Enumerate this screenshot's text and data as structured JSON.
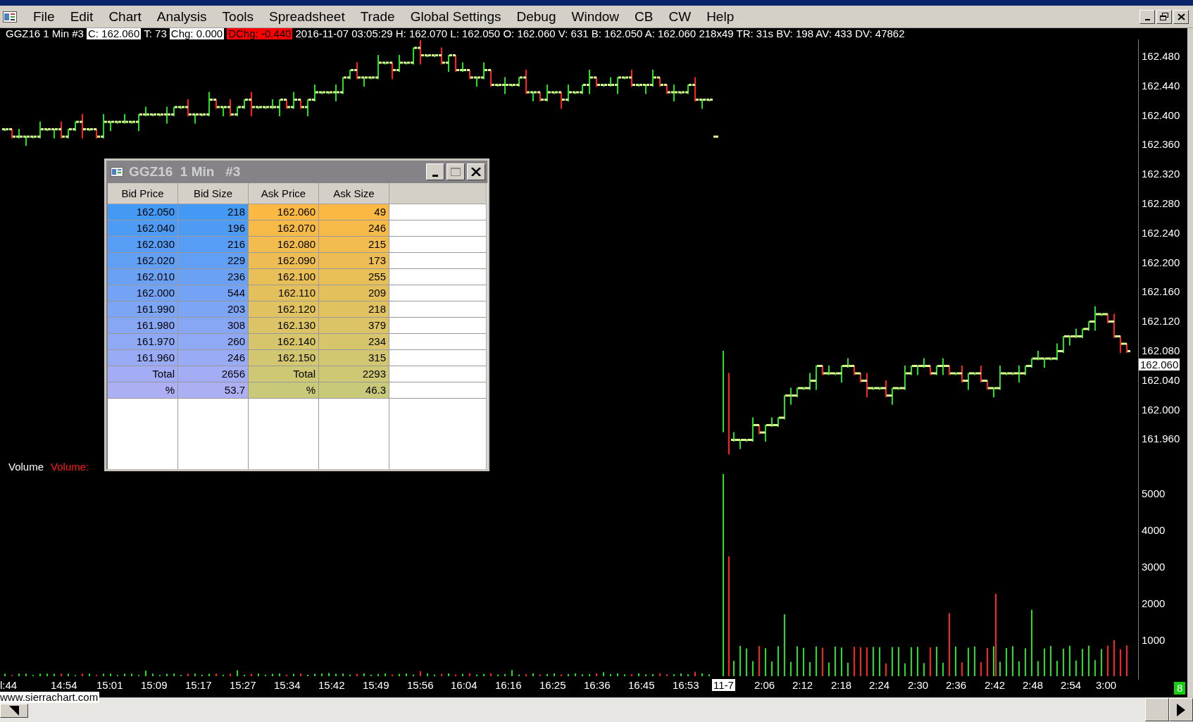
{
  "menu": [
    "File",
    "Edit",
    "Chart",
    "Analysis",
    "Tools",
    "Spreadsheet",
    "Trade",
    "Global Settings",
    "Debug",
    "Window",
    "CB",
    "CW",
    "Help"
  ],
  "info_line": [
    {
      "text": "GGZ16  1 Min  #3",
      "kind": "plain"
    },
    {
      "text": "C: 162.060",
      "kind": "boxed"
    },
    {
      "text": "T: 73",
      "kind": "plain"
    },
    {
      "text": "Chg: 0.000",
      "kind": "boxed"
    },
    {
      "text": "DChg: -0.440",
      "kind": "alert"
    },
    {
      "text": "2016-11-07 03:05:29 H: 162.070 L: 162.050 O: 162.060 V: 631 B: 162.050 A: 162.060 218x49 TR: 31s BV: 198 AV: 433 DV: 47862",
      "kind": "plain"
    }
  ],
  "price_axis": {
    "labels": [
      "162.480",
      "162.440",
      "162.400",
      "162.360",
      "162.320",
      "162.280",
      "162.240",
      "162.200",
      "162.160",
      "162.120",
      "162.080",
      "162.040",
      "162.000",
      "161.960"
    ],
    "current": "162.060"
  },
  "volume_axis": {
    "labels": [
      "5000",
      "4000",
      "3000",
      "2000",
      "1000"
    ]
  },
  "volume_legend": [
    {
      "text": "Volume",
      "kind": "name"
    },
    {
      "text": "Volume:",
      "kind": "value"
    }
  ],
  "time_axis": [
    {
      "text": "l:44",
      "kind": "plain"
    },
    {
      "text": "14:54",
      "kind": "plain"
    },
    {
      "text": "15:01",
      "kind": "plain"
    },
    {
      "text": "15:09",
      "kind": "plain"
    },
    {
      "text": "15:17",
      "kind": "plain"
    },
    {
      "text": "15:27",
      "kind": "plain"
    },
    {
      "text": "15:34",
      "kind": "plain"
    },
    {
      "text": "15:42",
      "kind": "plain"
    },
    {
      "text": "15:49",
      "kind": "plain"
    },
    {
      "text": "15:56",
      "kind": "plain"
    },
    {
      "text": "16:04",
      "kind": "plain"
    },
    {
      "text": "16:16",
      "kind": "plain"
    },
    {
      "text": "16:25",
      "kind": "plain"
    },
    {
      "text": "16:36",
      "kind": "plain"
    },
    {
      "text": "16:45",
      "kind": "plain"
    },
    {
      "text": "16:53",
      "kind": "plain"
    },
    {
      "text": "11-7",
      "kind": "date"
    },
    {
      "text": "2:06",
      "kind": "plain"
    },
    {
      "text": "2:12",
      "kind": "plain"
    },
    {
      "text": "2:18",
      "kind": "plain"
    },
    {
      "text": "2:24",
      "kind": "plain"
    },
    {
      "text": "2:30",
      "kind": "plain"
    },
    {
      "text": "2:36",
      "kind": "plain"
    },
    {
      "text": "2:42",
      "kind": "plain"
    },
    {
      "text": "2:48",
      "kind": "plain"
    },
    {
      "text": "2:54",
      "kind": "plain"
    },
    {
      "text": "3:00",
      "kind": "plain"
    }
  ],
  "watermark_link": "www.sierrachart.com",
  "status_badge": "8",
  "dom_window": {
    "title": "GGZ16  1 Min   #3",
    "columns": [
      "Bid Price",
      "Bid Size",
      "Ask Price",
      "Ask Size"
    ],
    "rows": [
      {
        "bid_price": "162.050",
        "bid_size": "218",
        "ask_price": "162.060",
        "ask_size": "49"
      },
      {
        "bid_price": "162.040",
        "bid_size": "196",
        "ask_price": "162.070",
        "ask_size": "246"
      },
      {
        "bid_price": "162.030",
        "bid_size": "216",
        "ask_price": "162.080",
        "ask_size": "215"
      },
      {
        "bid_price": "162.020",
        "bid_size": "229",
        "ask_price": "162.090",
        "ask_size": "173"
      },
      {
        "bid_price": "162.010",
        "bid_size": "236",
        "ask_price": "162.100",
        "ask_size": "255"
      },
      {
        "bid_price": "162.000",
        "bid_size": "544",
        "ask_price": "162.110",
        "ask_size": "209"
      },
      {
        "bid_price": "161.990",
        "bid_size": "203",
        "ask_price": "162.120",
        "ask_size": "218"
      },
      {
        "bid_price": "161.980",
        "bid_size": "308",
        "ask_price": "162.130",
        "ask_size": "379"
      },
      {
        "bid_price": "161.970",
        "bid_size": "260",
        "ask_price": "162.140",
        "ask_size": "234"
      },
      {
        "bid_price": "161.960",
        "bid_size": "246",
        "ask_price": "162.150",
        "ask_size": "315"
      },
      {
        "bid_price": "Total",
        "bid_size": "2656",
        "ask_price": "Total",
        "ask_size": "2293"
      },
      {
        "bid_price": "%",
        "bid_size": "53.7",
        "ask_price": "%",
        "ask_size": "46.3"
      }
    ]
  }
}
